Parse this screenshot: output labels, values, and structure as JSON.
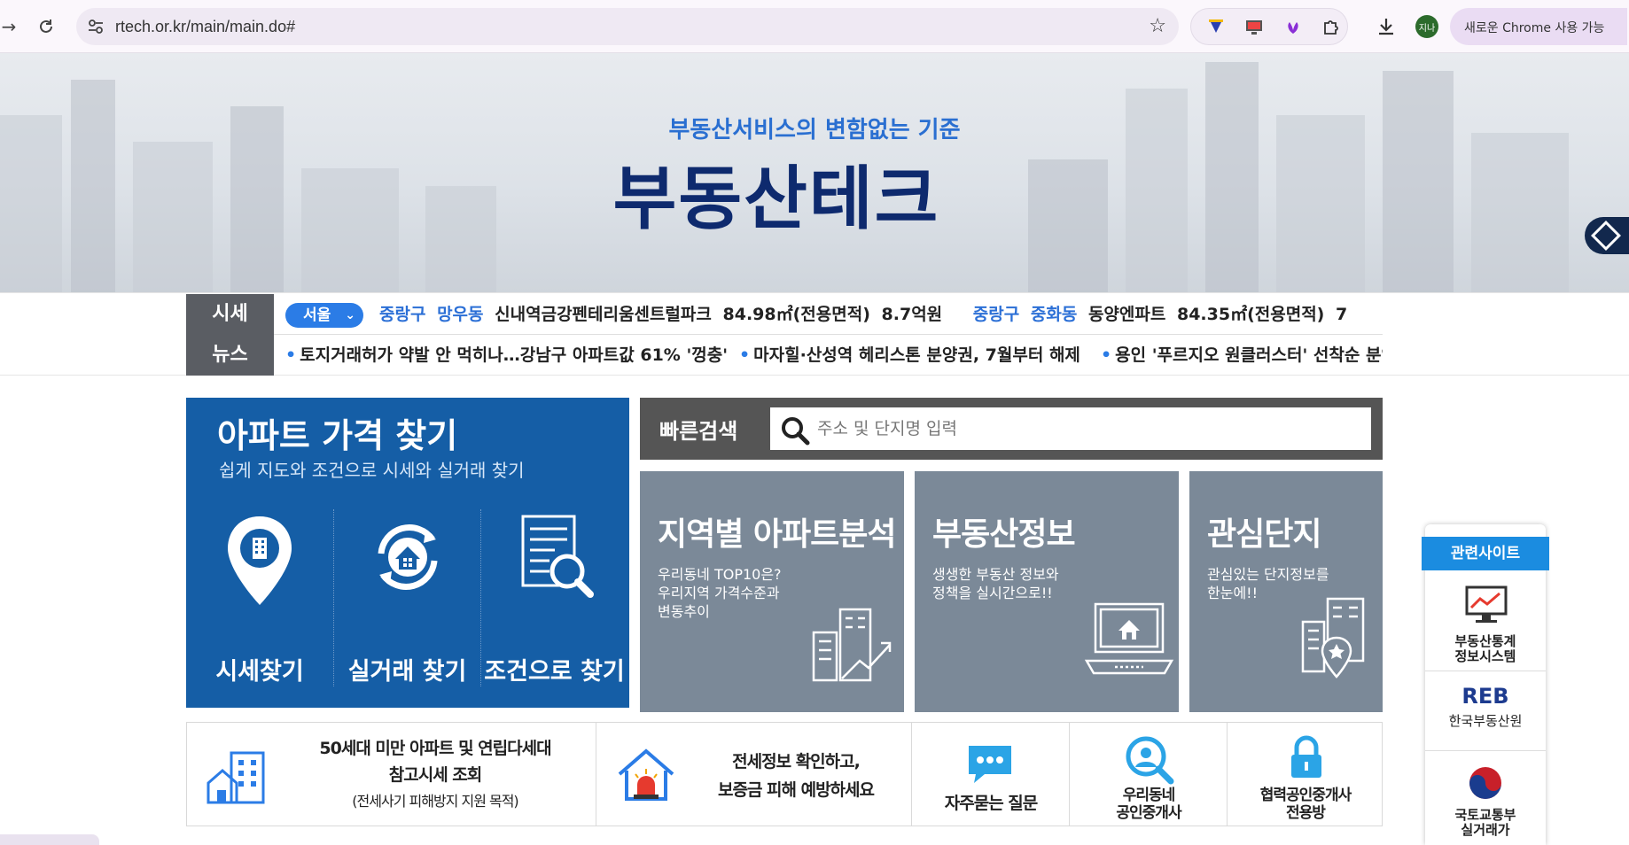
{
  "browser": {
    "url": "rtech.or.kr/main/main.do#",
    "avatar_text": "지나",
    "chrome_pill": "새로운 Chrome 사용 가능"
  },
  "hero": {
    "subtitle": "부동산서비스의 변함없는 기준",
    "title": "부동산테크"
  },
  "ticker": {
    "price_label": "시세",
    "region": "서울",
    "price_items": [
      {
        "district": "중랑구",
        "dong": "망우동",
        "apt": "신내역금강펜테리움센트럴파크",
        "area": "84.98㎡(전용면적)",
        "price": "8.7억원"
      },
      {
        "district": "중랑구",
        "dong": "중화동",
        "apt": "동양엔파트",
        "area": "84.35㎡(전용면적)",
        "price": "7"
      }
    ],
    "news_label": "뉴스",
    "news_items": [
      "토지거래허가 약발 안 먹히나…강남구 아파트값 61% '껑충'",
      "마자힐·산성역 헤리스톤 분양권, 7월부터 해제",
      "용인 '푸르지오 원클러스터' 선착순 분양"
    ]
  },
  "apt_finder": {
    "title": "아파트 가격 찾기",
    "subtitle": "쉽게 지도와 조건으로 시세와 실거래 찾기",
    "options": [
      "시세찾기",
      "실거래 찾기",
      "조건으로 찾기"
    ]
  },
  "quick_search": {
    "label": "빠른검색",
    "placeholder": "주소 및 단지명 입력"
  },
  "tiles": [
    {
      "title": "지역별 아파트분석",
      "desc": "우리동네 TOP10은?\n우리지역 가격수준과\n변동추이"
    },
    {
      "title": "부동산정보",
      "desc": "생생한 부동산 정보와\n정책을 실시간으로!!"
    },
    {
      "title": "관심단지",
      "desc": "관심있는 단지정보를\n한눈에!!"
    }
  ],
  "bottom": {
    "ref_price_line1": "50세대 미만 아파트 및 연립다세대",
    "ref_price_line2": "참고시세 조회",
    "ref_price_note": "(전세사기 피해방지 지원 목적)",
    "jeonse_line1": "전세정보 확인하고,",
    "jeonse_line2": "보증금 피해 예방하세요",
    "faq": "자주묻는 질문",
    "agent_line1": "우리동네",
    "agent_line2": "공인중개사",
    "partner_line1": "협력공인중개사",
    "partner_line2": "전용방"
  },
  "related": {
    "title": "관련사이트",
    "items": [
      {
        "line1": "부동산통계",
        "line2": "정보시스템"
      },
      {
        "line1": "한국부동산원",
        "logo": "REB"
      },
      {
        "line1": "국토교통부",
        "line2": "실거래가"
      }
    ]
  },
  "colors": {
    "primary_blue": "#155ea6",
    "accent_blue": "#2b7ce6",
    "tile_gray": "#7b8998",
    "dark_label": "#5a5d63"
  }
}
